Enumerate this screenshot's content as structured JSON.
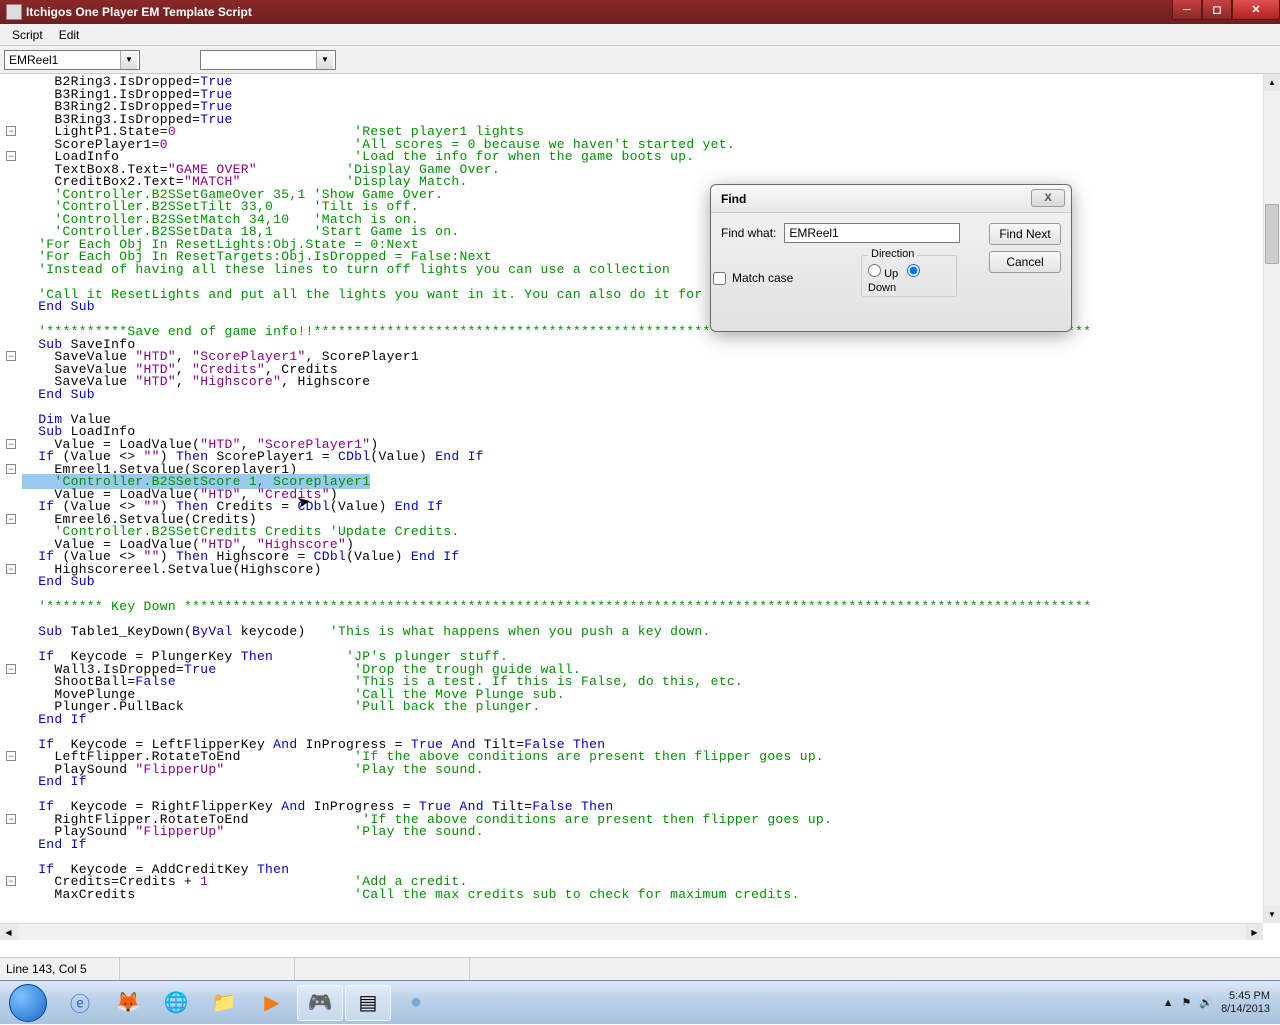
{
  "title": "Itchigos One Player EM Template Script",
  "menu": {
    "script": "Script",
    "edit": "Edit"
  },
  "combo1": "EMReel1",
  "status": "Line 143, Col 5",
  "fold_glyph": "−",
  "find": {
    "title": "Find",
    "label": "Find what:",
    "value": "EMReel1",
    "next": "Find Next",
    "cancel": "Cancel",
    "direction": "Direction",
    "up": "Up",
    "down": "Down",
    "match": "Match case",
    "close": "X"
  },
  "tray": {
    "time": "5:45 PM",
    "date": "8/14/2013",
    "flag_up": "▲"
  },
  "code": {
    "l1a": "    B2Ring3.IsDropped=",
    "l1b": "True",
    "l2a": "    B3Ring1.IsDropped=",
    "l2b": "True",
    "l3a": "    B3Ring2.IsDropped=",
    "l3b": "True",
    "l4a": "    B3Ring3.IsDropped=",
    "l4b": "True",
    "l5a": "    LightP1.State=",
    "l5b": "0",
    "l5c": "                      'Reset player1 lights",
    "l6a": "    ScorePlayer1=",
    "l6b": "0",
    "l6c": "                       'All scores = 0 because we haven't started yet.",
    "l7a": "    LoadInfo                             ",
    "l7c": "'Load the info for when the game boots up.",
    "l8a": "    TextBox8.Text=",
    "l8b": "\"GAME OVER\"",
    "l8c": "           'Display Game Over.",
    "l9a": "    CreditBox2.Text=",
    "l9b": "\"MATCH\"",
    "l9c": "             'Display Match.",
    "l10": "    'Controller.B2SSetGameOver 35,1 'Show Game Over.",
    "l11": "    'Controller.B2SSetTilt 33,0     'Tilt is off.",
    "l12": "    'Controller.B2SSetMatch 34,10   'Match is on.",
    "l13": "    'Controller.B2SSetData 18,1     'Start Game is on.",
    "l14": "  'For Each Obj In ResetLights:Obj.State = 0:Next",
    "l15": "  'For Each Obj In ResetTargets:Obj.IsDropped = False:Next",
    "l16": "  'Instead of having all these lines to turn off lights you can use a collection",
    "l17": "",
    "l18": "  'Call it ResetLights and put all the lights you want in it. You can also do it for targets.",
    "l19a": "  ",
    "l19b": "End Sub",
    "l20": "",
    "l21": "  '**********Save end of game info!!************************************************************************************************",
    "l22a": "  ",
    "l22s": "Sub",
    "l22b": " SaveInfo",
    "l23a": "    SaveValue ",
    "l23b": "\"HTD\"",
    "l23c": ", ",
    "l23d": "\"ScorePlayer1\"",
    "l23e": ", ScorePlayer1",
    "l24a": "    SaveValue ",
    "l24b": "\"HTD\"",
    "l24c": ", ",
    "l24d": "\"Credits\"",
    "l24e": ", Credits",
    "l25a": "    SaveValue ",
    "l25b": "\"HTD\"",
    "l25c": ", ",
    "l25d": "\"Highscore\"",
    "l25e": ", Highscore",
    "l26": "  End Sub",
    "l27": "",
    "l28a": "  ",
    "l28d": "Dim",
    "l28b": " Value",
    "l29a": "  ",
    "l29s": "Sub",
    "l29b": " LoadInfo",
    "l30a": "    Value = LoadValue(",
    "l30b": "\"HTD\"",
    "l30c": ", ",
    "l30d": "\"ScorePlayer1\"",
    "l30e": ")",
    "l31a": "  ",
    "l31i": "If",
    "l31b": " (Value <> ",
    "l31c": "\"\"",
    "l31d": ") ",
    "l31t": "Then",
    "l31e": " ScorePlayer1 = ",
    "l31cd": "CDbl",
    "l31f": "(Value) ",
    "l31ei": "End If",
    "l32": "    Emreel1.Setvalue(Scoreplayer1)",
    "l33": "    'Controller.B2SSetScore 1, Scoreplayer1",
    "l34a": "    Value = LoadValue(",
    "l34b": "\"HTD\"",
    "l34c": ", ",
    "l34d": "\"Credits\"",
    "l34e": ")",
    "l35a": "  ",
    "l35i": "If",
    "l35b": " (Value <> ",
    "l35c": "\"\"",
    "l35d": ") ",
    "l35t": "Then",
    "l35e": " Credits = ",
    "l35cd": "CDbl",
    "l35f": "(Value) ",
    "l35ei": "End If",
    "l36": "    Emreel6.Setvalue(Credits)",
    "l37": "    'Controller.B2SSetCredits Credits 'Update Credits.",
    "l38a": "    Value = LoadValue(",
    "l38b": "\"HTD\"",
    "l38c": ", ",
    "l38d": "\"Highscore\"",
    "l38e": ")",
    "l39a": "  ",
    "l39i": "If",
    "l39b": " (Value <> ",
    "l39c": "\"\"",
    "l39d": ") ",
    "l39t": "Then",
    "l39e": " Highscore = ",
    "l39cd": "CDbl",
    "l39f": "(Value) ",
    "l39ei": "End If",
    "l40": "    Highscorereel.Setvalue(Highscore)",
    "l41": "  End Sub",
    "l42": "",
    "l43": "  '******* Key Down ****************************************************************************************************************",
    "l44": "",
    "l45a": "  ",
    "l45s": "Sub",
    "l45b": " Table1_KeyDown(",
    "l45bv": "ByVal",
    "l45c": " keycode)   ",
    "l45cm": "'This is what happens when you push a key down.",
    "l46": "",
    "l47a": "  ",
    "l47i": "If",
    "l47b": "  Keycode = PlungerKey ",
    "l47t": "Then",
    "l47sp": "         ",
    "l47c": "'JP's plunger stuff.",
    "l48a": "    Wall3.IsDropped=",
    "l48t": "True",
    "l48sp": "                 ",
    "l48c": "'Drop the trough guide wall.",
    "l49a": "    ShootBall=",
    "l49f": "False",
    "l49sp": "                      ",
    "l49c": "'This is a test. If this is False, do this, etc.",
    "l50a": "    MovePlunge                           ",
    "l50c": "'Call the Move Plunge sub.",
    "l51a": "    Plunger.PullBack                     ",
    "l51c": "'Pull back the plunger.",
    "l52": "  End If",
    "l53": "",
    "l54a": "  ",
    "l54i": "If",
    "l54b": "  Keycode = LeftFlipperKey ",
    "l54a2": "And",
    "l54c": " InProgress = ",
    "l54t": "True",
    "l54a3": " And",
    "l54d": " Tilt=",
    "l54f": "False",
    "l54th": " Then",
    "l55a": "    LeftFlipper.RotateToEnd              ",
    "l55c": "'If the above conditions are present then flipper goes up.",
    "l56a": "    PlaySound ",
    "l56s": "\"FlipperUp\"",
    "l56sp": "                ",
    "l56c": "'Play the sound.",
    "l57": "  End If",
    "l58": "",
    "l59a": "  ",
    "l59i": "If",
    "l59b": "  Keycode = RightFlipperKey ",
    "l59a2": "And",
    "l59c": " InProgress = ",
    "l59t": "True",
    "l59a3": " And",
    "l59d": " Tilt=",
    "l59f": "False",
    "l59th": " Then",
    "l60a": "    RightFlipper.RotateToEnd              ",
    "l60c": "'If the above conditions are present then flipper goes up.",
    "l61a": "    PlaySound ",
    "l61s": "\"FlipperUp\"",
    "l61sp": "                ",
    "l61c": "'Play the sound.",
    "l62": "  End If",
    "l63": "",
    "l64a": "  ",
    "l64i": "If",
    "l64b": "  Keycode = AddCreditKey ",
    "l64t": "Then",
    "l65a": "    Credits=Credits + ",
    "l65n": "1",
    "l65sp": "                  ",
    "l65c": "'Add a credit.",
    "l66a": "    MaxCredits                           ",
    "l66c": "'Call the max credits sub to check for maximum credits."
  }
}
